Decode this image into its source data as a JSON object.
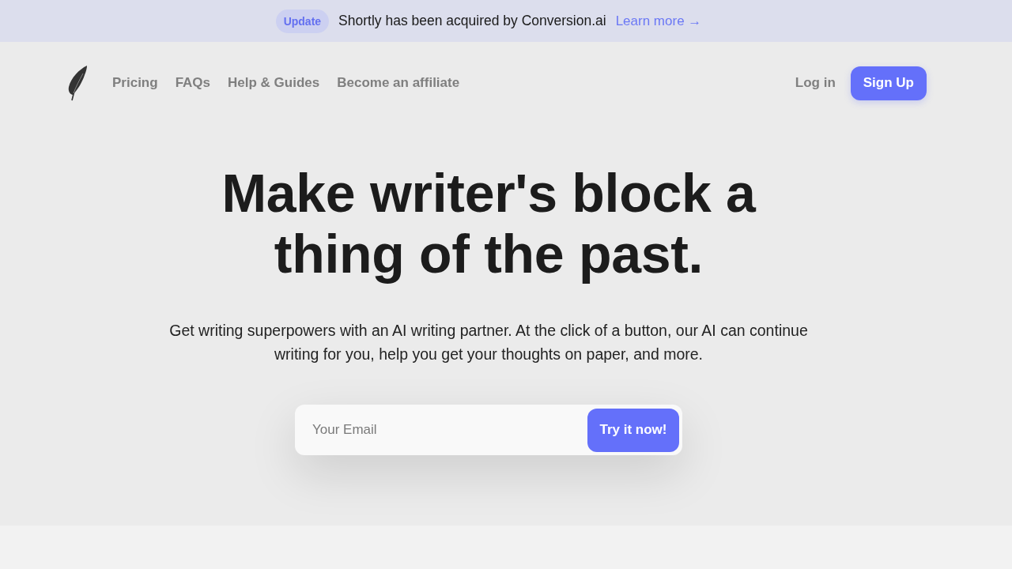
{
  "announcement": {
    "badge": "Update",
    "message": "Shortly has been acquired by Conversion.ai",
    "link": "Learn more →"
  },
  "nav": {
    "links": [
      "Pricing",
      "FAQs",
      "Help & Guides",
      "Become an affiliate"
    ],
    "login": "Log in",
    "signup": "Sign Up"
  },
  "hero": {
    "headline": "Make writer's block a thing of the past.",
    "subtitle": "Get writing superpowers with an AI writing partner. At the click of a button, our AI can continue writing for you, help you get your thoughts on paper, and more.",
    "email_field": {
      "placeholder": "Your Email"
    },
    "cta": "Try it now!"
  }
}
